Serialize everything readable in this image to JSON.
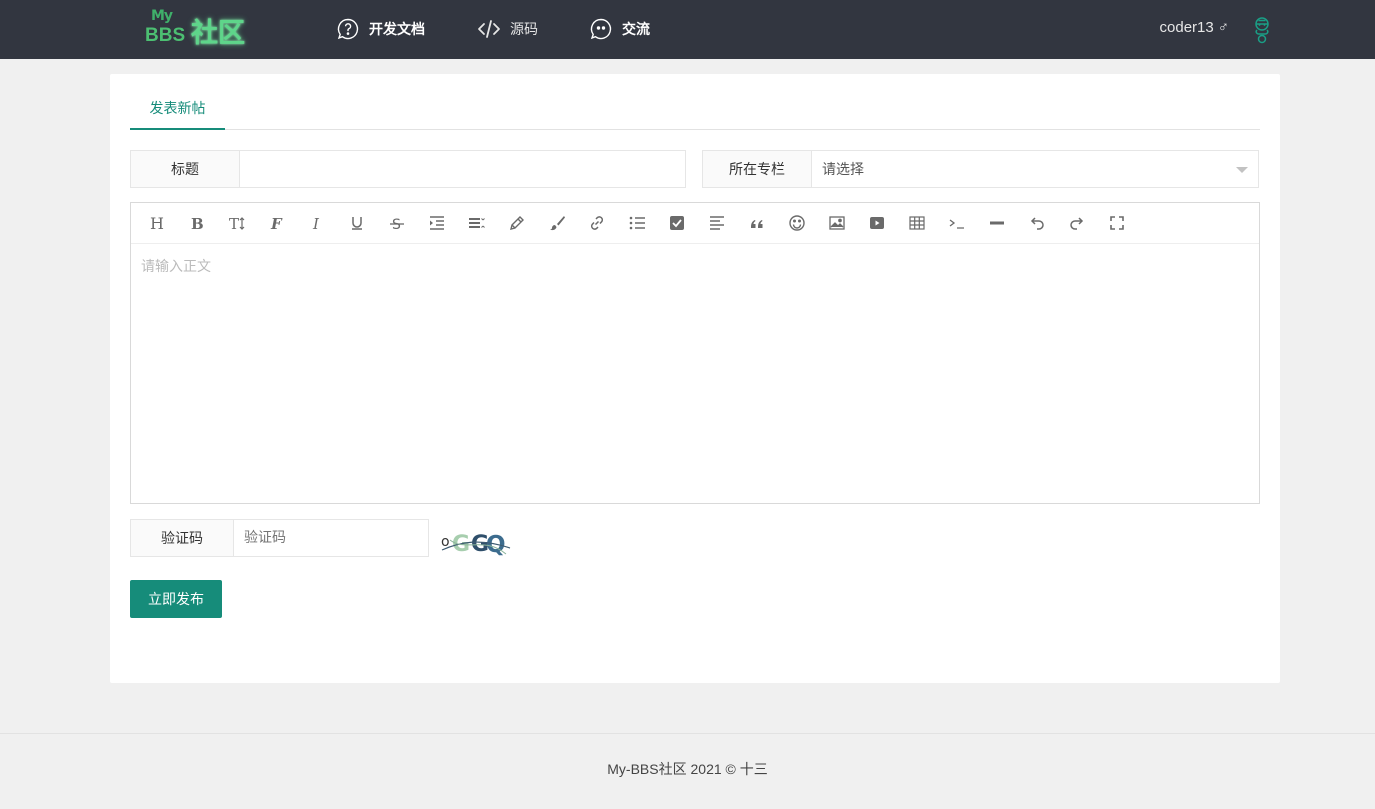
{
  "header": {
    "logo": {
      "my": "My",
      "bbs": "BBS",
      "cn": "社区"
    },
    "nav": [
      {
        "label": "开发文档",
        "icon": "question-bubble-icon"
      },
      {
        "label": "源码",
        "icon": "code-icon"
      },
      {
        "label": "交流",
        "icon": "chat-bubble-icon"
      }
    ],
    "user": {
      "name": "coder13",
      "gender_symbol": "♂",
      "avatar": "avatar-icon"
    }
  },
  "form": {
    "tab_label": "发表新帖",
    "title": {
      "label": "标题",
      "value": "",
      "placeholder": ""
    },
    "column": {
      "label": "所在专栏",
      "selected": "请选择"
    },
    "editor": {
      "placeholder": "请输入正文",
      "toolbar": [
        "heading-icon",
        "bold-icon",
        "text-size-icon",
        "font-icon",
        "italic-icon",
        "underline-icon",
        "strikethrough-icon",
        "indent-icon",
        "line-height-icon",
        "pen-icon",
        "brush-icon",
        "link-icon",
        "list-icon",
        "checkbox-icon",
        "align-icon",
        "quote-icon",
        "emoji-icon",
        "image-icon",
        "video-icon",
        "table-icon",
        "code-block-icon",
        "hr-icon",
        "undo-icon",
        "redo-icon",
        "fullscreen-icon"
      ]
    },
    "captcha": {
      "label": "验证码",
      "placeholder": "验证码",
      "image_text": "oGGQ"
    },
    "submit_label": "立即发布"
  },
  "footer": {
    "text": "My-BBS社区 2021 ©   十三"
  },
  "colors": {
    "accent": "#168c7a",
    "header_bg": "#323640",
    "page_bg": "#f0f0f0"
  }
}
